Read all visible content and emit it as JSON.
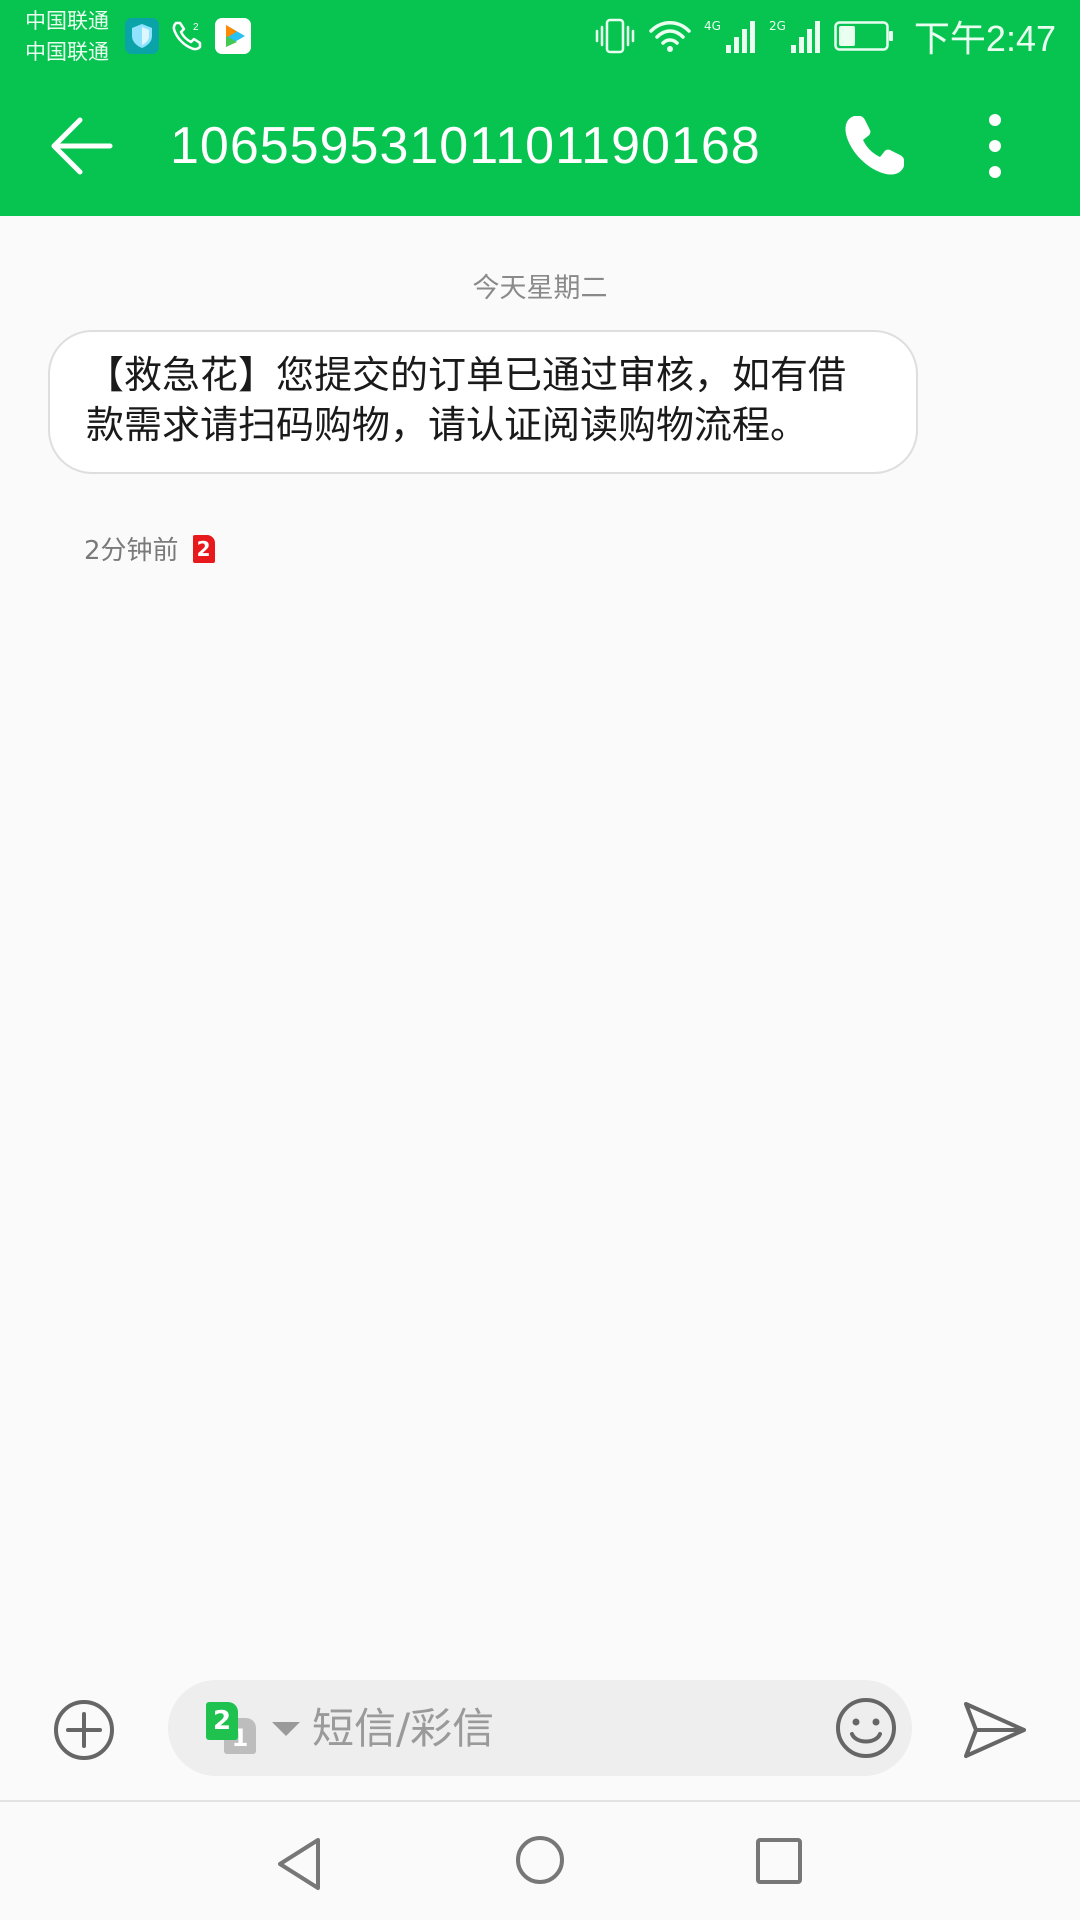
{
  "status_bar": {
    "carrier_1": "中国联通",
    "carrier_2": "中国联通",
    "network_1": "4G",
    "network_2": "2G",
    "time": "下午2:47",
    "battery_level": 0.35,
    "icons": [
      "security-shield-icon",
      "wifi-call-icon",
      "video-app-icon",
      "vibrate-icon",
      "wifi-icon",
      "signal-icon",
      "battery-icon"
    ]
  },
  "app_bar": {
    "title": "10655953101101190168",
    "background_color": "#07c451"
  },
  "conversation": {
    "date_divider": "今天星期二",
    "messages": [
      {
        "text": "【救急花】您提交的订单已通过审核，如有借款需求请扫码购物，请认证阅读购物流程。",
        "time": "2分钟前",
        "sim_badge": "2"
      }
    ]
  },
  "composer": {
    "sim_primary": "2",
    "sim_secondary": "1",
    "placeholder": "短信/彩信",
    "value": ""
  }
}
